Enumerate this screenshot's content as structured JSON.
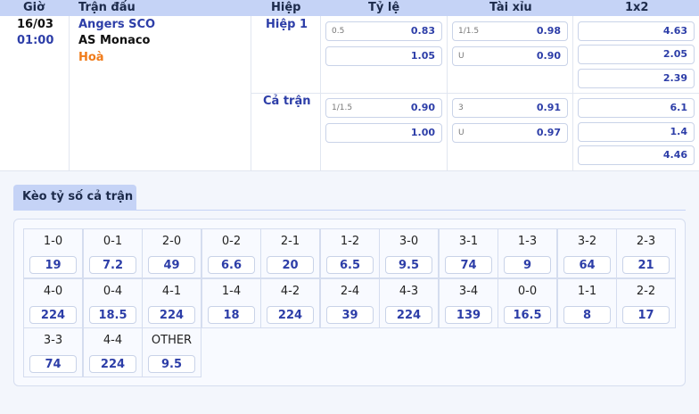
{
  "header": {
    "time": "Giờ",
    "match": "Trận đấu",
    "half": "Hiệp",
    "handicap": "Tỷ lệ",
    "overunder": "Tài xỉu",
    "x12": "1x2"
  },
  "match": {
    "date": "16/03",
    "time": "01:00",
    "home": "Angers SCO",
    "away": "AS Monaco",
    "draw": "Hoà"
  },
  "first_half": {
    "label": "Hiệp 1",
    "handicap": [
      {
        "line": "0.5",
        "odds": "0.83"
      },
      {
        "line": "",
        "odds": "1.05"
      }
    ],
    "overunder": [
      {
        "line": "1/1.5",
        "odds": "0.98"
      },
      {
        "line": "U",
        "odds": "0.90"
      }
    ],
    "x12": [
      "4.63",
      "2.05",
      "2.39"
    ]
  },
  "full_time": {
    "label": "Cả trận",
    "handicap": [
      {
        "line": "1/1.5",
        "odds": "0.90"
      },
      {
        "line": "",
        "odds": "1.00"
      }
    ],
    "overunder": [
      {
        "line": "3",
        "odds": "0.91"
      },
      {
        "line": "U",
        "odds": "0.97"
      }
    ],
    "x12": [
      "6.1",
      "1.4",
      "4.46"
    ]
  },
  "score_tab": "Kèo tỷ số cả trận",
  "scores": [
    [
      {
        "s": "1-0",
        "o": "19"
      },
      {
        "s": "0-1",
        "o": "7.2"
      },
      {
        "s": "2-0",
        "o": "49"
      },
      {
        "s": "0-2",
        "o": "6.6"
      },
      {
        "s": "2-1",
        "o": "20"
      },
      {
        "s": "1-2",
        "o": "6.5"
      },
      {
        "s": "3-0",
        "o": "9.5"
      },
      {
        "s": "3-1",
        "o": "74"
      },
      {
        "s": "1-3",
        "o": "9"
      },
      {
        "s": "3-2",
        "o": "64"
      },
      {
        "s": "2-3",
        "o": "21"
      }
    ],
    [
      {
        "s": "4-0",
        "o": "224"
      },
      {
        "s": "0-4",
        "o": "18.5"
      },
      {
        "s": "4-1",
        "o": "224"
      },
      {
        "s": "1-4",
        "o": "18"
      },
      {
        "s": "4-2",
        "o": "224"
      },
      {
        "s": "2-4",
        "o": "39"
      },
      {
        "s": "4-3",
        "o": "224"
      },
      {
        "s": "3-4",
        "o": "139"
      },
      {
        "s": "0-0",
        "o": "16.5"
      },
      {
        "s": "1-1",
        "o": "8"
      },
      {
        "s": "2-2",
        "o": "17"
      }
    ],
    [
      {
        "s": "3-3",
        "o": "74"
      },
      {
        "s": "4-4",
        "o": "224"
      },
      {
        "s": "OTHER",
        "o": "9.5"
      }
    ]
  ]
}
